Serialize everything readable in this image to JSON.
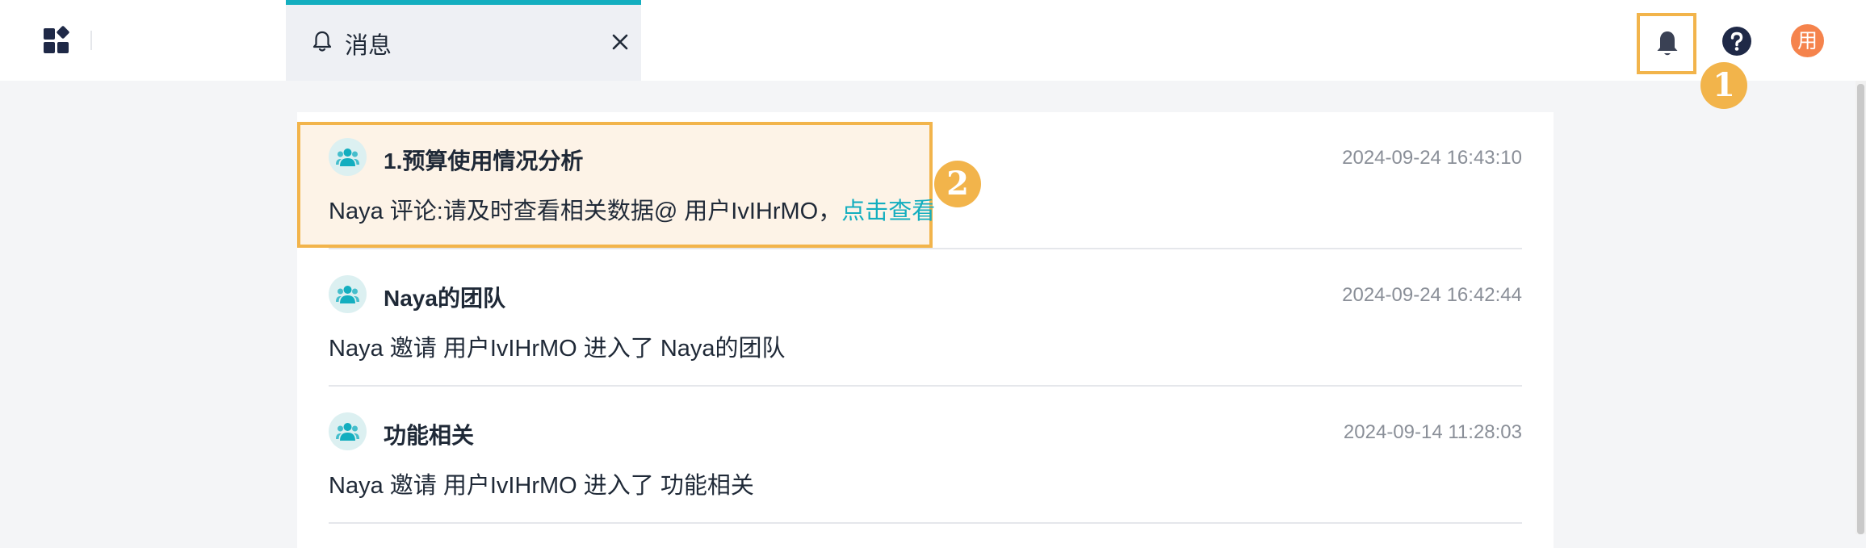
{
  "header": {
    "tab": {
      "label": "消息"
    },
    "avatar_text": "用"
  },
  "callouts": {
    "one": "1",
    "two": "2"
  },
  "messages": [
    {
      "title": "1.预算使用情况分析",
      "time": "2024-09-24 16:43:10",
      "body": "Naya 评论:请及时查看相关数据@ 用户IvIHrMO，",
      "link": "点击查看"
    },
    {
      "title": "Naya的团队",
      "time": "2024-09-24 16:42:44",
      "body": "Naya 邀请 用户IvIHrMO 进入了 Naya的团队"
    },
    {
      "title": "功能相关",
      "time": "2024-09-14 11:28:03",
      "body": "Naya 邀请 用户IvIHrMO 进入了 功能相关"
    }
  ],
  "colors": {
    "accent": "#13aebf",
    "highlight": "#f2b44b",
    "avatar": "#f5834c",
    "dark": "#1f2947"
  },
  "icons": [
    "apps-icon",
    "bell-icon",
    "close-icon",
    "notification-bell-icon",
    "help-icon",
    "team-icon"
  ]
}
